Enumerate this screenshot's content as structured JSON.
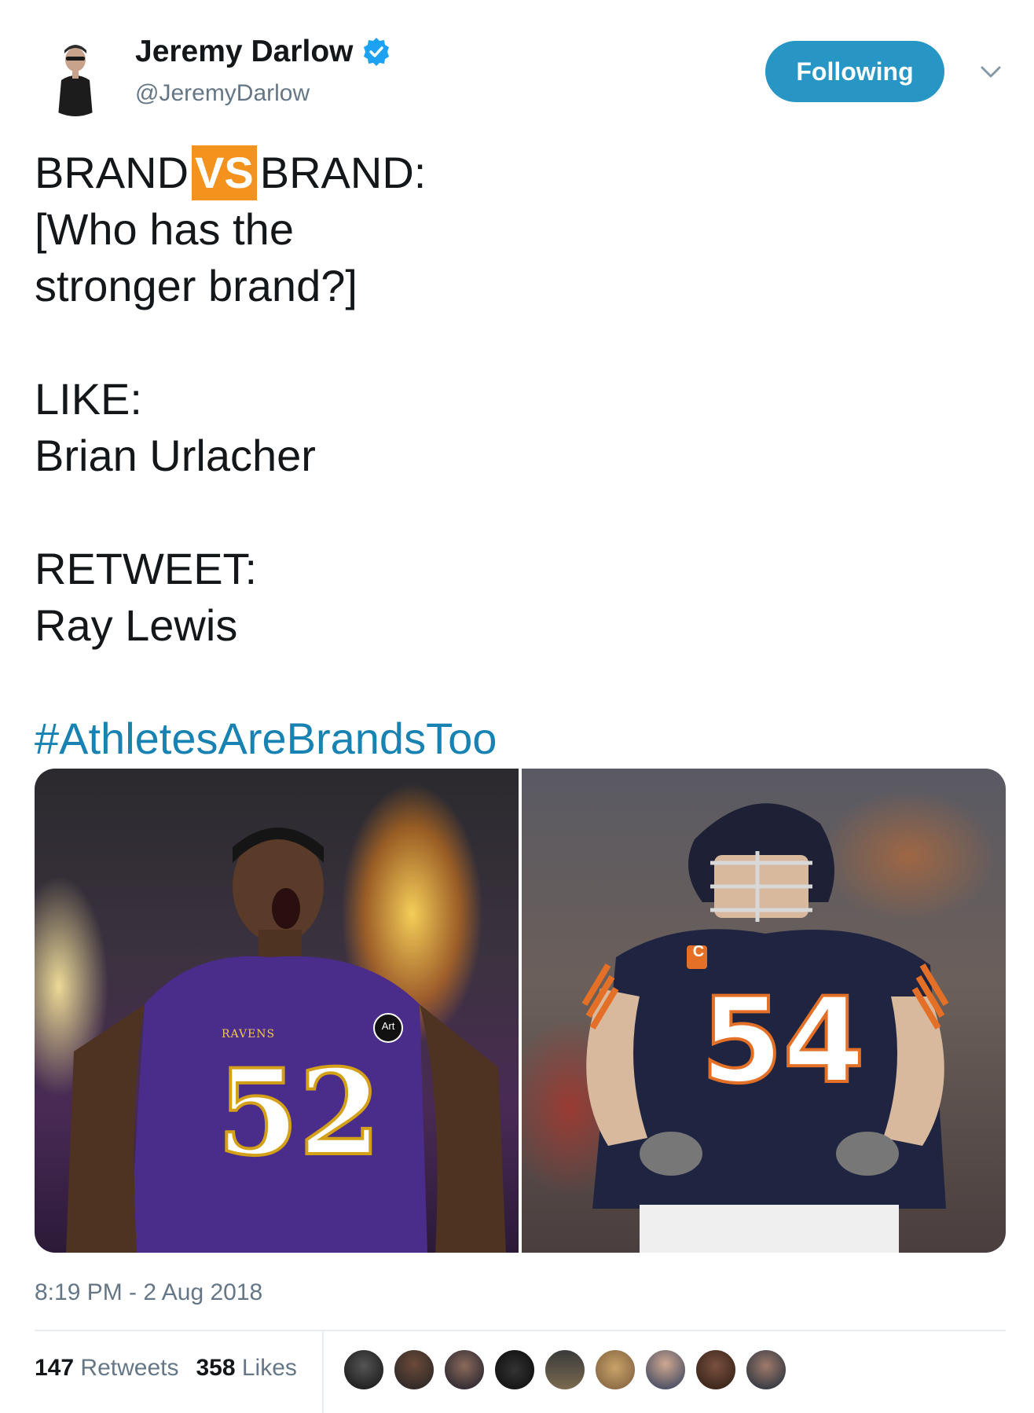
{
  "author": {
    "display_name": "Jeremy Darlow",
    "handle": "@JeremyDarlow",
    "verified_icon": "verified-badge-icon",
    "avatar_icon": "user-avatar"
  },
  "follow_button": {
    "label": "Following"
  },
  "menu": {
    "icon": "chevron-down-icon"
  },
  "tweet": {
    "line1_prefix": "BRAND",
    "line1_vs": "VS",
    "line1_suffix": "BRAND:",
    "line2": "[Who has the",
    "line3": "stronger brand?]",
    "like_label": "LIKE:",
    "like_value": "Brian Urlacher",
    "retweet_label": "RETWEET:",
    "retweet_value": "Ray Lewis",
    "hashtag": "#AthletesAreBrandsToo"
  },
  "media": {
    "left_photo": "Ray Lewis #52 Ravens photo",
    "right_photo": "Brian Urlacher #54 Bears photo",
    "left_jersey_number": "52",
    "left_team": "RAVENS",
    "left_patch": "Art",
    "right_jersey_number": "54",
    "right_captain_patch": "C"
  },
  "timestamp": "8:19 PM - 2 Aug 2018",
  "stats": {
    "retweets_count": "147",
    "retweets_label": "Retweets",
    "likes_count": "358",
    "likes_label": "Likes"
  },
  "colors": {
    "follow_button": "#2796c4",
    "vs_badge": "#f4921e",
    "hashtag": "#1883b3",
    "secondary_text": "#657786"
  }
}
